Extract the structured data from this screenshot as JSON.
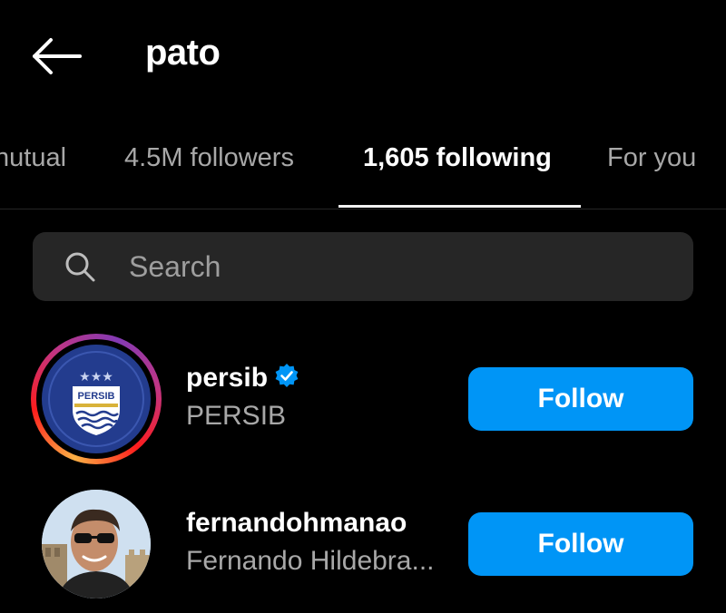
{
  "header": {
    "title": "pato",
    "back_icon": "arrow-left-icon"
  },
  "tabs": [
    {
      "label": "nutual",
      "active": false
    },
    {
      "label": "4.5M followers",
      "active": false
    },
    {
      "label": "1,605 following",
      "active": true
    },
    {
      "label": "For you",
      "active": false
    }
  ],
  "search": {
    "placeholder": "Search",
    "value": "",
    "icon": "search-icon"
  },
  "accounts": [
    {
      "username": "persib",
      "full_name": "PERSIB",
      "verified": true,
      "has_story_ring": true,
      "avatar_logo_text": "PERSIB",
      "avatar_stars": "★★★",
      "follow_label": "Follow"
    },
    {
      "username": "fernandohmanao",
      "full_name": "Fernando Hildebra...",
      "verified": false,
      "has_story_ring": false,
      "follow_label": "Follow"
    }
  ],
  "colors": {
    "background": "#000000",
    "follow_button": "#0095f6",
    "search_bg": "#262626",
    "secondary_text": "#a8a8a8",
    "verified_badge": "#0095f6"
  }
}
